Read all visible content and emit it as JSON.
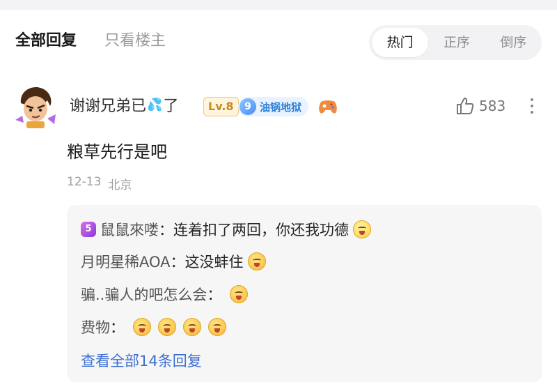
{
  "tabs": {
    "all": "全部回复",
    "op_only": "只看楼主"
  },
  "sort": {
    "hot": "热门",
    "asc": "正序",
    "desc": "倒序"
  },
  "comment": {
    "user_prefix": "谢谢兄弟已",
    "user_suffix": "了",
    "level": "Lv.8",
    "fan_level": "9",
    "fan_group": "油锅地狱",
    "likes": "583",
    "text": "粮草先行是吧",
    "date": "12-13",
    "location": "北京"
  },
  "replies": [
    {
      "badge": "5",
      "name": "鼠鼠來喽",
      "sep": "：",
      "text": "连着扣了两回，你还我功德",
      "emojis": 1
    },
    {
      "name": "月明星稀AOA",
      "sep": "：",
      "text": "这没蚌住",
      "emojis": 1
    },
    {
      "name": "骗..骗人的吧怎么会",
      "sep": "：",
      "text": "",
      "emojis": 1
    },
    {
      "name": "费物",
      "sep": "：",
      "text": "",
      "emojis": 4
    }
  ],
  "view_all": "查看全部14条回复",
  "icons": {
    "like": "thumbs-up-icon",
    "more": "more-vertical-icon",
    "game": "gamepad-icon",
    "emoji": "laughing-face-emoji"
  },
  "colors": {
    "link": "#3b6ed6",
    "level": "#c98a22",
    "fan": "#2e7ed8"
  }
}
